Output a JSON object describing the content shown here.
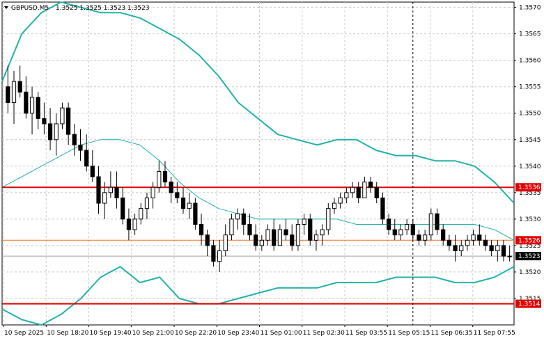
{
  "header": {
    "symbol_timeframe": "GBPUSD,M5",
    "quote": "1.3525 1.3525 1.3523 1.3523"
  },
  "colors": {
    "background": "#ffffff",
    "grid": "#c8c8c8",
    "candle": "#000000",
    "bollinger": "#20b2aa",
    "level_line": "#e00000",
    "level_label_bg": "#e00000",
    "mid_price_line": "#f07020",
    "current_price_label_bg": "#000000",
    "vertical_marker": "#000000"
  },
  "chart_data": {
    "type": "candlestick",
    "symbol": "GBPUSD",
    "timeframe": "M5",
    "grid": true,
    "ylim": [
      1.351,
      1.3571
    ],
    "y_ticks": [
      "1.3570",
      "1.3565",
      "1.3560",
      "1.3555",
      "1.3550",
      "1.3545",
      "1.3540",
      "1.3535",
      "1.3530",
      "1.3525",
      "1.3520",
      "1.3515"
    ],
    "x_ticks": [
      "10 Sep 2025",
      "10 Sep 18:20",
      "10 Sep 19:40",
      "10 Sep 21:00",
      "10 Sep 22:20",
      "10 Sep 23:40",
      "11 Sep 01:00",
      "11 Sep 02:30",
      "11 Sep 03:55",
      "11 Sep 05:15",
      "11 Sep 06:35",
      "11 Sep 07:55"
    ],
    "marked_price_labels": [
      {
        "text": "1.3536",
        "value": 1.3536,
        "style": "level"
      },
      {
        "text": "1.3526",
        "value": 1.3526,
        "style": "level"
      },
      {
        "text": "1.3523",
        "value": 1.3523,
        "style": "current"
      },
      {
        "text": "1.3514",
        "value": 1.3514,
        "style": "level"
      }
    ],
    "horizontal_lines": [
      {
        "value": 1.3536,
        "kind": "level"
      },
      {
        "value": 1.3514,
        "kind": "level"
      },
      {
        "value": 1.3526,
        "kind": "mid"
      }
    ],
    "vertical_marker_x_index": 67,
    "bollinger_upper": [
      1.3556,
      1.3565,
      1.3569,
      1.3571,
      1.357,
      1.3569,
      1.3569,
      1.3568,
      1.3566,
      1.3564,
      1.3561,
      1.3557,
      1.3552,
      1.3549,
      1.3546,
      1.3545,
      1.3544,
      1.3545,
      1.3545,
      1.3543,
      1.3542,
      1.3542,
      1.3541,
      1.3541,
      1.354,
      1.3537,
      1.3533
    ],
    "bollinger_middle": [
      1.3536,
      1.3538,
      1.354,
      1.3542,
      1.3544,
      1.3545,
      1.3545,
      1.3544,
      1.3541,
      1.3537,
      1.3534,
      1.3532,
      1.3531,
      1.353,
      1.353,
      1.353,
      1.353,
      1.353,
      1.3529,
      1.3529,
      1.3529,
      1.3529,
      1.3529,
      1.3529,
      1.3529,
      1.3528,
      1.3526
    ],
    "bollinger_lower": [
      1.3513,
      1.3511,
      1.351,
      1.3512,
      1.3515,
      1.3519,
      1.3521,
      1.3518,
      1.3519,
      1.3515,
      1.3514,
      1.3514,
      1.3515,
      1.3516,
      1.3517,
      1.3517,
      1.3517,
      1.3518,
      1.3518,
      1.3518,
      1.3519,
      1.3519,
      1.3519,
      1.3518,
      1.3518,
      1.3519,
      1.3521
    ],
    "candles": [
      [
        1.3555,
        1.3559,
        1.355,
        1.3552
      ],
      [
        1.3552,
        1.3558,
        1.3548,
        1.3556
      ],
      [
        1.3556,
        1.3559,
        1.3553,
        1.3554
      ],
      [
        1.3554,
        1.3557,
        1.3549,
        1.355
      ],
      [
        1.355,
        1.3555,
        1.3546,
        1.3553
      ],
      [
        1.3553,
        1.3554,
        1.3547,
        1.3549
      ],
      [
        1.3549,
        1.3552,
        1.3546,
        1.3548
      ],
      [
        1.3548,
        1.3551,
        1.3543,
        1.3545
      ],
      [
        1.3545,
        1.355,
        1.3542,
        1.3548
      ],
      [
        1.3548,
        1.3552,
        1.3547,
        1.3551
      ],
      [
        1.3551,
        1.3552,
        1.3544,
        1.3546
      ],
      [
        1.3546,
        1.3548,
        1.3542,
        1.3544
      ],
      [
        1.3544,
        1.3547,
        1.3541,
        1.3543
      ],
      [
        1.3543,
        1.3546,
        1.3539,
        1.354
      ],
      [
        1.354,
        1.3543,
        1.3537,
        1.3538
      ],
      [
        1.3538,
        1.354,
        1.3531,
        1.3533
      ],
      [
        1.3533,
        1.3537,
        1.353,
        1.3535
      ],
      [
        1.3535,
        1.3539,
        1.3534,
        1.3536
      ],
      [
        1.3536,
        1.3539,
        1.3532,
        1.3534
      ],
      [
        1.3534,
        1.3536,
        1.3529,
        1.353
      ],
      [
        1.353,
        1.3532,
        1.3526,
        1.3528
      ],
      [
        1.3528,
        1.3531,
        1.3527,
        1.353
      ],
      [
        1.353,
        1.3533,
        1.3529,
        1.3532
      ],
      [
        1.3532,
        1.3535,
        1.353,
        1.3534
      ],
      [
        1.3534,
        1.3537,
        1.3532,
        1.3536
      ],
      [
        1.3536,
        1.3541,
        1.3535,
        1.3539
      ],
      [
        1.3539,
        1.3541,
        1.3536,
        1.3537
      ],
      [
        1.3537,
        1.3538,
        1.3533,
        1.3535
      ],
      [
        1.3535,
        1.3537,
        1.3533,
        1.3534
      ],
      [
        1.3534,
        1.3536,
        1.3531,
        1.3532
      ],
      [
        1.3532,
        1.3535,
        1.353,
        1.3533
      ],
      [
        1.3533,
        1.3534,
        1.3528,
        1.3529
      ],
      [
        1.3529,
        1.3531,
        1.3525,
        1.3527
      ],
      [
        1.3527,
        1.3528,
        1.3523,
        1.3525
      ],
      [
        1.3525,
        1.3526,
        1.3521,
        1.3522
      ],
      [
        1.3522,
        1.3526,
        1.352,
        1.3524
      ],
      [
        1.3524,
        1.3529,
        1.3523,
        1.3527
      ],
      [
        1.3527,
        1.3531,
        1.3526,
        1.353
      ],
      [
        1.353,
        1.3532,
        1.3528,
        1.3531
      ],
      [
        1.3531,
        1.3532,
        1.3527,
        1.3529
      ],
      [
        1.3529,
        1.3531,
        1.3526,
        1.3527
      ],
      [
        1.3527,
        1.3529,
        1.3524,
        1.3525
      ],
      [
        1.3525,
        1.3527,
        1.3524,
        1.3526
      ],
      [
        1.3526,
        1.3529,
        1.3525,
        1.3528
      ],
      [
        1.3528,
        1.353,
        1.3524,
        1.3525
      ],
      [
        1.3525,
        1.3529,
        1.3525,
        1.3528
      ],
      [
        1.3528,
        1.353,
        1.3526,
        1.3527
      ],
      [
        1.3527,
        1.3529,
        1.3524,
        1.3525
      ],
      [
        1.3525,
        1.353,
        1.3524,
        1.3529
      ],
      [
        1.3529,
        1.3531,
        1.3527,
        1.353
      ],
      [
        1.353,
        1.3531,
        1.3525,
        1.3526
      ],
      [
        1.3526,
        1.3528,
        1.3524,
        1.3527
      ],
      [
        1.3527,
        1.3529,
        1.3525,
        1.3528
      ],
      [
        1.3528,
        1.3533,
        1.3527,
        1.3532
      ],
      [
        1.3532,
        1.3534,
        1.3531,
        1.3533
      ],
      [
        1.3533,
        1.3535,
        1.3532,
        1.3534
      ],
      [
        1.3534,
        1.3536,
        1.3533,
        1.3535
      ],
      [
        1.3535,
        1.3537,
        1.3534,
        1.3536
      ],
      [
        1.3536,
        1.3537,
        1.3533,
        1.3534
      ],
      [
        1.3534,
        1.3538,
        1.3534,
        1.3537
      ],
      [
        1.3537,
        1.3538,
        1.3535,
        1.3536
      ],
      [
        1.3536,
        1.3537,
        1.3533,
        1.3534
      ],
      [
        1.3534,
        1.3535,
        1.3529,
        1.353
      ],
      [
        1.353,
        1.3531,
        1.3527,
        1.3528
      ],
      [
        1.3528,
        1.353,
        1.3526,
        1.3527
      ],
      [
        1.3527,
        1.3529,
        1.3526,
        1.3528
      ],
      [
        1.3528,
        1.353,
        1.3527,
        1.3529
      ],
      [
        1.3529,
        1.353,
        1.3526,
        1.3527
      ],
      [
        1.3527,
        1.3528,
        1.3525,
        1.3526
      ],
      [
        1.3526,
        1.3528,
        1.3525,
        1.3527
      ],
      [
        1.3527,
        1.3532,
        1.3526,
        1.3531
      ],
      [
        1.3531,
        1.3532,
        1.3527,
        1.3528
      ],
      [
        1.3528,
        1.3529,
        1.3525,
        1.3526
      ],
      [
        1.3526,
        1.3527,
        1.3524,
        1.3525
      ],
      [
        1.3525,
        1.3527,
        1.3522,
        1.3524
      ],
      [
        1.3524,
        1.3526,
        1.3523,
        1.3525
      ],
      [
        1.3525,
        1.3527,
        1.3524,
        1.3526
      ],
      [
        1.3526,
        1.3528,
        1.3525,
        1.3527
      ],
      [
        1.3527,
        1.3529,
        1.3525,
        1.3526
      ],
      [
        1.3526,
        1.3527,
        1.3524,
        1.3525
      ],
      [
        1.3525,
        1.3526,
        1.3523,
        1.3524
      ],
      [
        1.3524,
        1.3526,
        1.3522,
        1.3525
      ],
      [
        1.3525,
        1.3526,
        1.3522,
        1.3523
      ],
      [
        1.3523,
        1.3525,
        1.3522,
        1.3523
      ]
    ]
  }
}
